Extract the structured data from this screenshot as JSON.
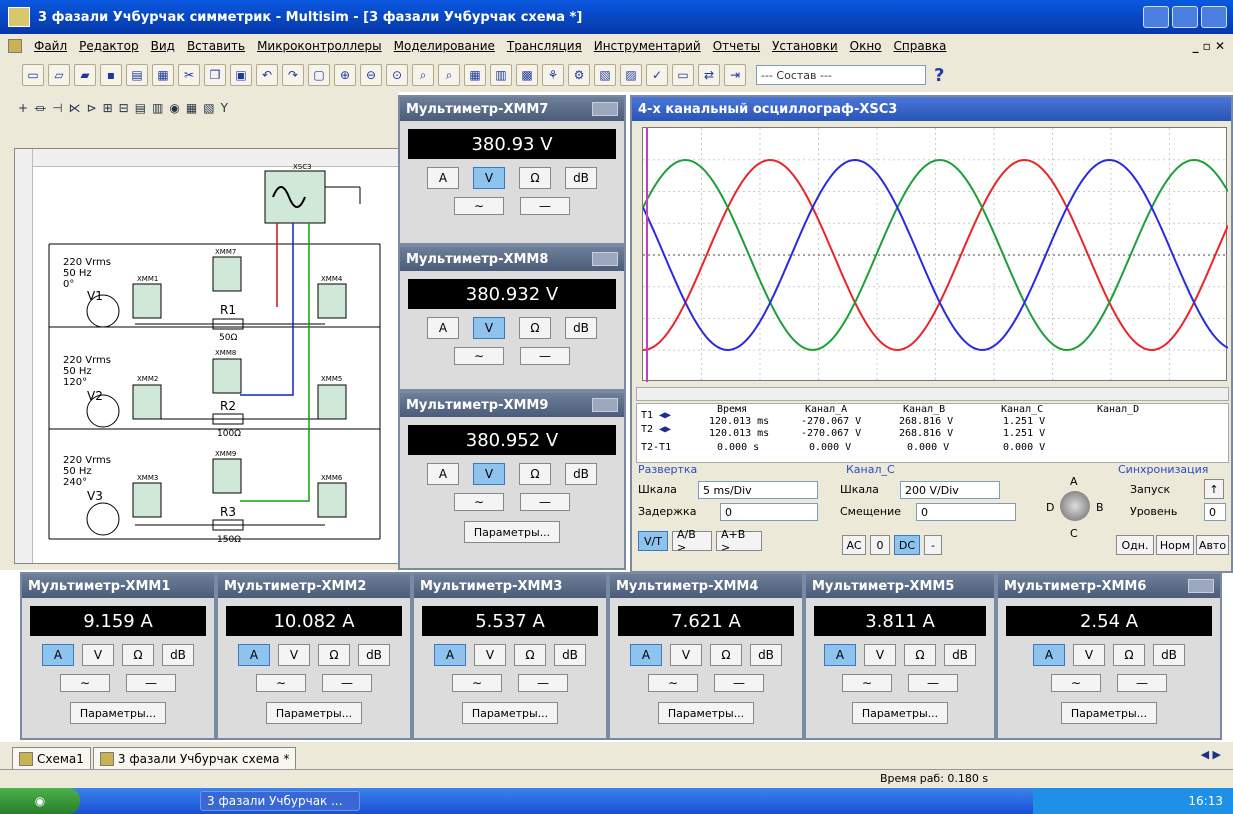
{
  "window": {
    "title": "3 фазали Учбурчак симметрик - Multisim - [3 фазали Учбурчак схема *]"
  },
  "menu": [
    "Файл",
    "Редактор",
    "Вид",
    "Вставить",
    "Микроконтроллеры",
    "Моделирование",
    "Трансляция",
    "Инструментарий",
    "Отчеты",
    "Установки",
    "Окно",
    "Справка"
  ],
  "toolbar": {
    "combo": "--- Состав ---",
    "help": "?"
  },
  "schematic": {
    "sources": [
      {
        "label": "220 Vrms\n50 Hz\n0°",
        "name": "V1"
      },
      {
        "label": "220 Vrms\n50 Hz\n120°",
        "name": "V2"
      },
      {
        "label": "220 Vrms\n50 Hz\n240°",
        "name": "V3"
      }
    ],
    "resistors": [
      {
        "name": "R1",
        "value": "50Ω"
      },
      {
        "name": "R2",
        "value": "100Ω"
      },
      {
        "name": "R3",
        "value": "150Ω"
      }
    ],
    "meters": [
      "XMM1",
      "XMM2",
      "XMM3",
      "XMM4",
      "XMM5",
      "XMM6",
      "XMM7",
      "XMM8",
      "XMM9"
    ],
    "osc": "XSC3"
  },
  "mmv": [
    {
      "title": "Мультиметр-XMM7",
      "value": "380.93 V"
    },
    {
      "title": "Мультиметр-XMM8",
      "value": "380.932 V"
    },
    {
      "title": "Мультиметр-XMM9",
      "value": "380.952 V"
    }
  ],
  "mma": [
    {
      "title": "Мультиметр-XMM1",
      "value": "9.159 A"
    },
    {
      "title": "Мультиметр-XMM2",
      "value": "10.082 A"
    },
    {
      "title": "Мультиметр-XMM3",
      "value": "5.537 A"
    },
    {
      "title": "Мультиметр-XMM4",
      "value": "7.621 A"
    },
    {
      "title": "Мультиметр-XMM5",
      "value": "3.811 A"
    },
    {
      "title": "Мультиметр-XMM6",
      "value": "2.54 A"
    }
  ],
  "mm_buttons": {
    "a": "A",
    "v": "V",
    "ohm": "Ω",
    "db": "dB",
    "params": "Параметры..."
  },
  "osc": {
    "title": "4-х канальный осциллограф-XSC3",
    "readout": {
      "headers": [
        "Время",
        "Канал_A",
        "Канал_B",
        "Канал_C",
        "Канал_D"
      ],
      "t1": [
        "120.013 ms",
        "-270.067 V",
        "268.816 V",
        "1.251 V"
      ],
      "t2": [
        "120.013 ms",
        "-270.067 V",
        "268.816 V",
        "1.251 V"
      ],
      "dt": [
        "0.000 s",
        "0.000 V",
        "0.000 V",
        "0.000 V"
      ],
      "labels": [
        "T1",
        "T2",
        "T2-T1"
      ]
    },
    "sweep": {
      "group": "Развертка",
      "scale_label": "Шкала",
      "scale": "5 ms/Div",
      "delay_label": "Задержка",
      "delay": "0"
    },
    "channel": {
      "group": "Канал_C",
      "scale_label": "Шкала",
      "scale": "200 V/Div",
      "offset_label": "Смещение",
      "offset": "0"
    },
    "trig": {
      "group": "Синхронизация",
      "start_label": "Запуск",
      "level_label": "Уровень",
      "level": "0"
    },
    "buttons": {
      "vt": "V/T",
      "ab": "A/B >",
      "apb": "A+B >",
      "ac": "AC",
      "zero": "0",
      "dc": "DC",
      "minus": "-",
      "one": "Одн.",
      "norm": "Норм",
      "auto": "Авто"
    },
    "knob": {
      "a": "A",
      "b": "B",
      "c": "C",
      "d": "D"
    },
    "series_colors": {
      "a": "#e8262a",
      "b": "#1e9e3a",
      "c": "#2a2ae0"
    }
  },
  "tabs": [
    {
      "label": "Схема1"
    },
    {
      "label": "3 фазали Учбурчак схема *"
    }
  ],
  "status": {
    "run_time": "Время раб: 0.180 s"
  },
  "taskbar": {
    "item": "3 фазали Учбурчак ...",
    "clock": "16:13"
  }
}
